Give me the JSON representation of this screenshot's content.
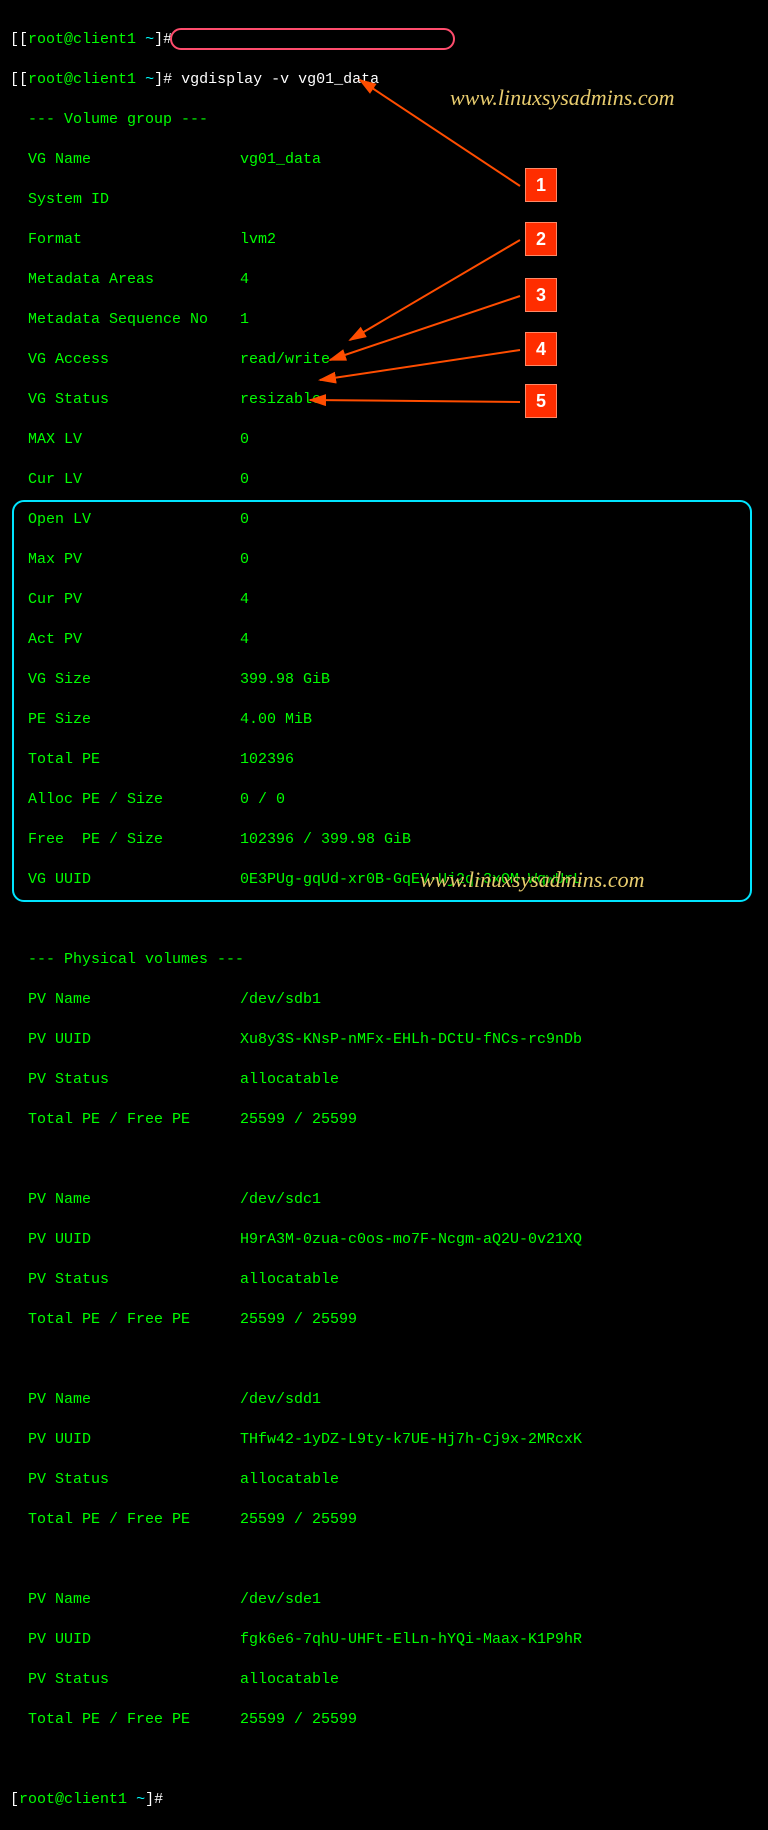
{
  "prompt1_user": "root@client1",
  "prompt1_path": "~",
  "prompt1_hash": "]#",
  "prompt2_user": "root@client1",
  "prompt2_path": "~",
  "prompt2_hash": "]#",
  "command": "vgdisplay -v vg01_data",
  "prompt3_user": "root@client1",
  "prompt3_path": "~",
  "prompt3_hash": "]#",
  "vg_header": "  --- Volume group ---",
  "vg": {
    "name_l": "  VG Name",
    "name_v": "vg01_data",
    "sysid_l": "  System ID",
    "sysid_v": "",
    "format_l": "  Format",
    "format_v": "lvm2",
    "metaarea_l": "  Metadata Areas",
    "metaarea_v": "4",
    "metaseq_l": "  Metadata Sequence No",
    "metaseq_v": "1",
    "access_l": "  VG Access",
    "access_v": "read/write",
    "status_l": "  VG Status",
    "status_v": "resizable",
    "maxlv_l": "  MAX LV",
    "maxlv_v": "0",
    "curlv_l": "  Cur LV",
    "curlv_v": "0",
    "openlv_l": "  Open LV",
    "openlv_v": "0",
    "maxpv_l": "  Max PV",
    "maxpv_v": "0",
    "curpv_l": "  Cur PV",
    "curpv_v": "4",
    "actpv_l": "  Act PV",
    "actpv_v": "4",
    "vgsize_l": "  VG Size",
    "vgsize_v": "399.98 GiB",
    "pesize_l": "  PE Size",
    "pesize_v": "4.00 MiB",
    "totpe_l": "  Total PE",
    "totpe_v": "102396",
    "alloc_l": "  Alloc PE / Size",
    "alloc_v": "0 / 0",
    "free_l": "  Free  PE / Size",
    "free_v": "102396 / 399.98 GiB",
    "uuid_l": "  VG UUID",
    "uuid_v": "0E3PUg-gqUd-xr0B-GqEV-Uj2q-3xOM-WqwUrL"
  },
  "pv_header": "  --- Physical volumes ---",
  "pv": [
    {
      "name_l": "  PV Name",
      "name_v": "/dev/sdb1",
      "uuid_l": "  PV UUID",
      "uuid_v": "Xu8y3S-KNsP-nMFx-EHLh-DCtU-fNCs-rc9nDb",
      "status_l": "  PV Status",
      "status_v": "allocatable",
      "pe_l": "  Total PE / Free PE",
      "pe_v": "25599 / 25599"
    },
    {
      "name_l": "  PV Name",
      "name_v": "/dev/sdc1",
      "uuid_l": "  PV UUID",
      "uuid_v": "H9rA3M-0zua-c0os-mo7F-Ncgm-aQ2U-0v21XQ",
      "status_l": "  PV Status",
      "status_v": "allocatable",
      "pe_l": "  Total PE / Free PE",
      "pe_v": "25599 / 25599"
    },
    {
      "name_l": "  PV Name",
      "name_v": "/dev/sdd1",
      "uuid_l": "  PV UUID",
      "uuid_v": "THfw42-1yDZ-L9ty-k7UE-Hj7h-Cj9x-2MRcxK",
      "status_l": "  PV Status",
      "status_v": "allocatable",
      "pe_l": "  Total PE / Free PE",
      "pe_v": "25599 / 25599"
    },
    {
      "name_l": "  PV Name",
      "name_v": "/dev/sde1",
      "uuid_l": "  PV UUID",
      "uuid_v": "fgk6e6-7qhU-UHFt-ElLn-hYQi-Maax-K1P9hR",
      "status_l": "  PV Status",
      "status_v": "allocatable",
      "pe_l": "  Total PE / Free PE",
      "pe_v": "25599 / 25599"
    }
  ],
  "watermark": "www.linuxsysadmins.com",
  "badges": {
    "b1": "1",
    "b2": "2",
    "b3": "3",
    "b4": "4",
    "b5": "5"
  }
}
